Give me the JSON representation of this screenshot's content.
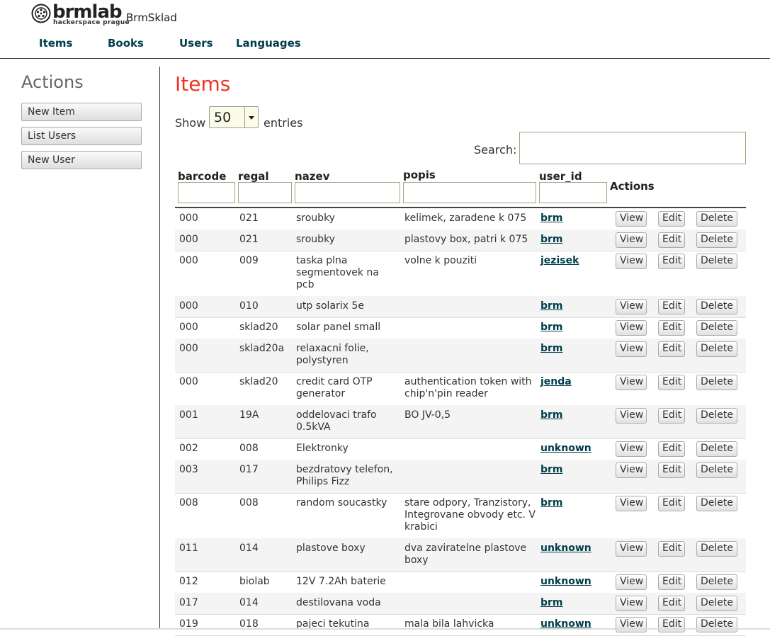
{
  "header": {
    "logo_word": "brmlab",
    "logo_tagline": "hackerspace prague",
    "app_title": "BrmSklad",
    "nav": [
      "Items",
      "Books",
      "Users",
      "Languages"
    ]
  },
  "sidebar": {
    "title": "Actions",
    "buttons": [
      "New Item",
      "List Users",
      "New User"
    ]
  },
  "main": {
    "title": "Items",
    "show_prefix": "Show",
    "page_length": "50",
    "show_suffix": "entries",
    "search_label": "Search:",
    "search_value": "",
    "columns": [
      "barcode",
      "regal",
      "nazev",
      "popis",
      "user_id",
      "Actions"
    ],
    "action_labels": [
      "View",
      "Edit",
      "Delete"
    ],
    "rows": [
      {
        "barcode": "000",
        "regal": "021",
        "nazev": "sroubky",
        "popis": "kelimek, zaradene k 075",
        "user": "brm"
      },
      {
        "barcode": "000",
        "regal": "021",
        "nazev": "sroubky",
        "popis": "plastovy box, patri k 075",
        "user": "brm"
      },
      {
        "barcode": "000",
        "regal": "009",
        "nazev": "taska plna segmentovek na pcb",
        "popis": "volne k pouziti",
        "user": "jezisek"
      },
      {
        "barcode": "000",
        "regal": "010",
        "nazev": "utp solarix 5e",
        "popis": "",
        "user": "brm"
      },
      {
        "barcode": "000",
        "regal": "sklad20",
        "nazev": "solar panel small",
        "popis": "",
        "user": "brm"
      },
      {
        "barcode": "000",
        "regal": "sklad20a",
        "nazev": "relaxacni folie, polystyren",
        "popis": "",
        "user": "brm"
      },
      {
        "barcode": "000",
        "regal": "sklad20",
        "nazev": "credit card OTP generator",
        "popis": "authentication token with chip'n'pin reader",
        "user": "jenda"
      },
      {
        "barcode": "001",
        "regal": "19A",
        "nazev": "oddelovaci trafo 0.5kVA",
        "popis": "BO JV-0,5",
        "user": "brm"
      },
      {
        "barcode": "002",
        "regal": "008",
        "nazev": "Elektronky",
        "popis": "",
        "user": "unknown"
      },
      {
        "barcode": "003",
        "regal": "017",
        "nazev": "bezdratovy telefon, Philips Fizz",
        "popis": "",
        "user": "brm"
      },
      {
        "barcode": "008",
        "regal": "008",
        "nazev": "random soucastky",
        "popis": "stare odpory, Tranzistory, Integrovane obvody etc. V krabici",
        "user": "brm"
      },
      {
        "barcode": "011",
        "regal": "014",
        "nazev": "plastove boxy",
        "popis": "dva zaviratelne plastove boxy",
        "user": "unknown"
      },
      {
        "barcode": "012",
        "regal": "biolab",
        "nazev": "12V 7.2Ah baterie",
        "popis": "",
        "user": "unknown"
      },
      {
        "barcode": "017",
        "regal": "014",
        "nazev": "destilovana voda",
        "popis": "",
        "user": "brm"
      },
      {
        "barcode": "019",
        "regal": "018",
        "nazev": "pajeci tekutina",
        "popis": "mala bila lahvicka",
        "user": "unknown"
      }
    ]
  },
  "colors": {
    "title_red": "#ee3322",
    "link_teal": "#003d4c"
  }
}
